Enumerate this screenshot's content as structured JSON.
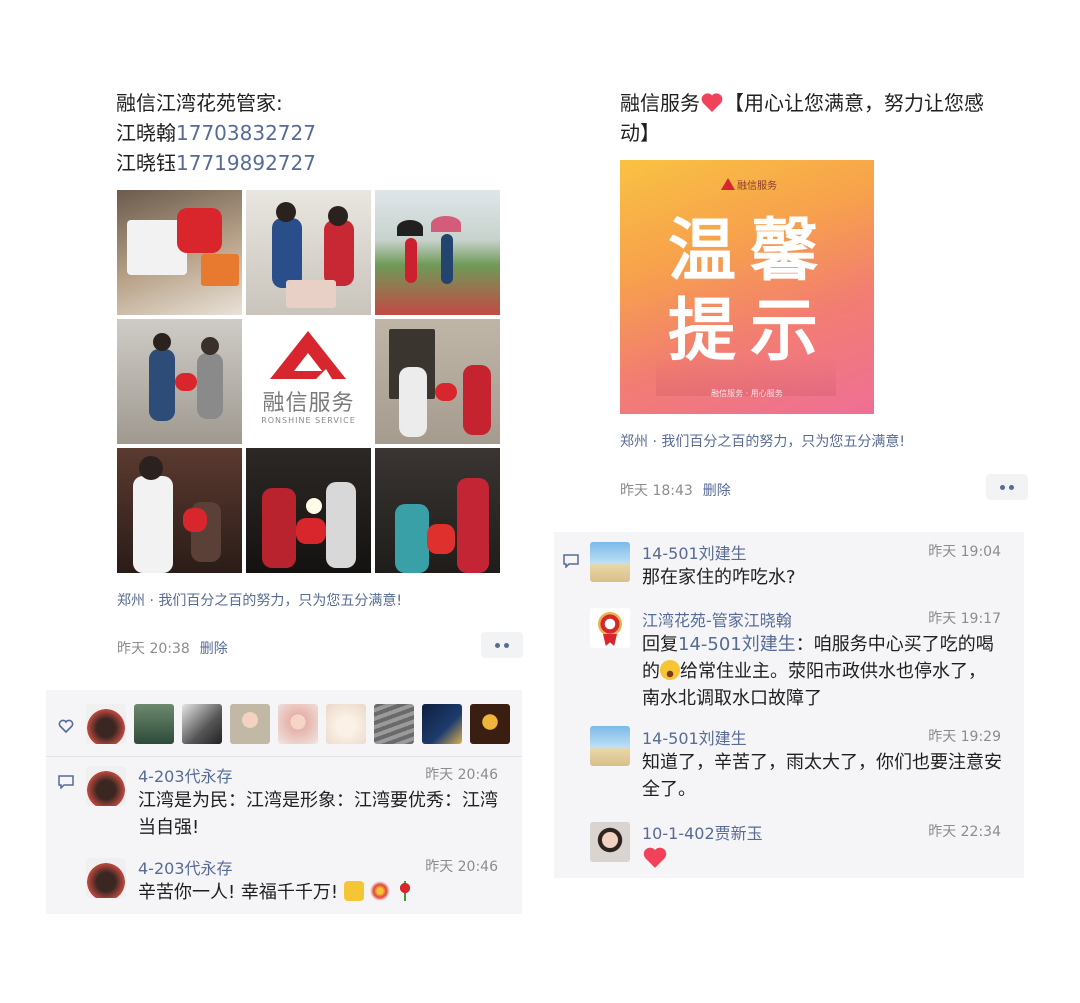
{
  "left_post": {
    "text_line1": "融信江湾花苑管家:",
    "contact1_name": "江晓翰",
    "contact1_phone": "17703832727",
    "contact2_name": "江晓钰",
    "contact2_phone": "17719892727",
    "logo_text": "融信服务",
    "logo_sub": "RONSHINE SERVICE",
    "location": "郑州 · 我们百分之百的努力，只为您五分满意!",
    "time": "昨天 20:38",
    "delete_label": "删除"
  },
  "left_comments": [
    {
      "name": "4-203代永存",
      "time": "昨天 20:46",
      "text_line1": "江湾是为民：江湾是形象：江湾要优秀：江湾",
      "text_line2": "当自强!"
    },
    {
      "name": "4-203代永存",
      "time": "昨天 20:46",
      "text": "辛苦你一人! 幸福千千万!"
    }
  ],
  "right_post": {
    "title_prefix": "融信服务",
    "title_suffix": "【用心让您满意，努力让您感",
    "title_line2": "动】",
    "poster_brand": "融信服务",
    "poster_title_line1": "温馨",
    "poster_title_line2": "提示",
    "poster_footer": "融信服务 · 用心服务",
    "location": "郑州 · 我们百分之百的努力，只为您五分满意!",
    "time": "昨天 18:43",
    "delete_label": "删除"
  },
  "right_comments": [
    {
      "name": "14-501刘建生",
      "time": "昨天 19:04",
      "text": "那在家住的咋吃水?"
    },
    {
      "name": "江湾花苑-管家江晓翰",
      "time": "昨天 19:17",
      "reply_label": "回复",
      "reply_to": "14-501刘建生",
      "text_line1_rest": "：咱服务中心买了吃的喝",
      "text_line2_a": "的",
      "text_line2_b": "给常住业主。荥阳市政供水也停水了，",
      "text_line3": "南水北调取水口故障了"
    },
    {
      "name": "14-501刘建生",
      "time": "昨天 19:29",
      "text_line1": "知道了，辛苦了，雨太大了，你们也要注意安",
      "text_line2": "全了。"
    },
    {
      "name": "10-1-402贾新玉",
      "time": "昨天 22:34"
    }
  ],
  "colors": {
    "link": "#576b95",
    "brand_red": "#d7262e",
    "heart": "#f0435b"
  }
}
